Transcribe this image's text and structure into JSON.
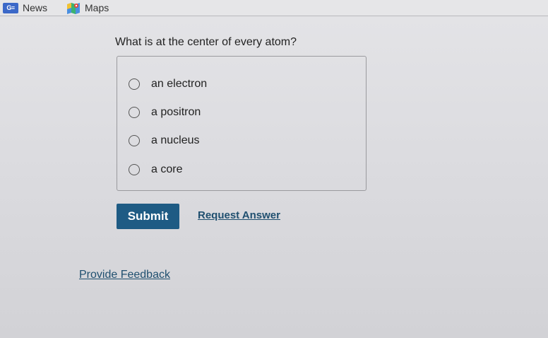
{
  "bookmarks": {
    "news": {
      "icon_text": "G≡",
      "label": "News",
      "icon": "news-icon"
    },
    "maps": {
      "label": "Maps",
      "icon": "maps-icon"
    }
  },
  "question": {
    "text": "What is at the center of every atom?"
  },
  "options": [
    {
      "label": "an electron",
      "selected": false
    },
    {
      "label": "a positron",
      "selected": false
    },
    {
      "label": "a nucleus",
      "selected": false
    },
    {
      "label": "a core",
      "selected": false
    }
  ],
  "actions": {
    "submit_label": "Submit",
    "request_answer_label": "Request Answer",
    "provide_feedback_label": "Provide Feedback"
  },
  "colors": {
    "submit_bg": "#1e5b84",
    "link": "#1f4f6f",
    "news_icon_bg": "#3b68c8"
  }
}
